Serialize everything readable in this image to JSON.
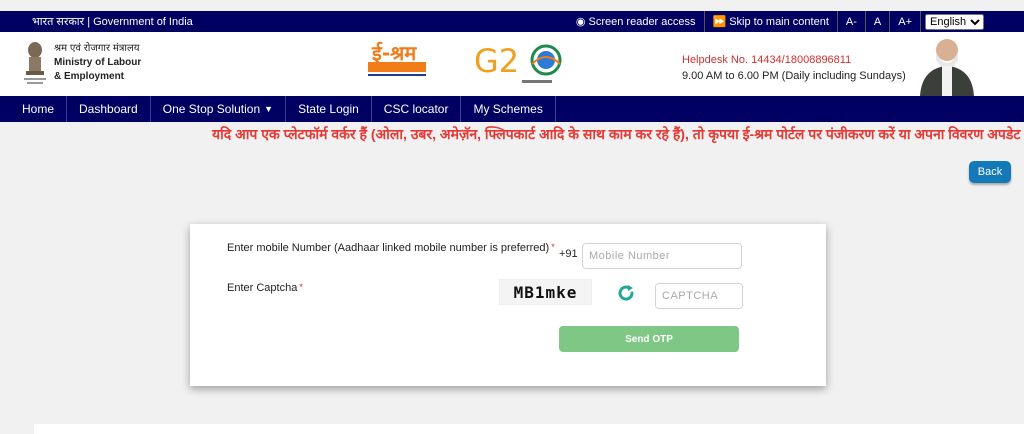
{
  "topbar": {
    "gov_text": "भारत सरकार | Government of India",
    "screen_reader": "Screen reader access",
    "skip_main": "Skip to main content",
    "font_minus": "A-",
    "font_normal": "A",
    "font_plus": "A+",
    "language": "English"
  },
  "header": {
    "ministry_hi": "श्रम एवं रोजगार मंत्रालय",
    "ministry_en_1": "Ministry of Labour",
    "ministry_en_2": "& Employment",
    "eshram_logo_text": "ई-श्रम",
    "g20_text": "G20",
    "helpdesk_no": "Helpdesk No. 14434/18008896811",
    "helpdesk_hours": "9.00 AM to 6.00 PM (Daily including Sundays)"
  },
  "nav": {
    "items": [
      "Home",
      "Dashboard",
      "One Stop Solution",
      "State Login",
      "CSC locator",
      "My Schemes"
    ]
  },
  "ticker": "यदि आप एक प्लेटफॉर्म वर्कर हैं (ओला, उबर, अमेज़ॅन, फ्लिपकार्ट आदि के साथ काम कर रहे हैं), तो कृपया ई-श्रम पोर्टल पर पंजीकरण करें या अपना विवरण अपडेट क",
  "back_label": "Back",
  "form": {
    "mobile_label": "Enter mobile Number (Aadhaar linked mobile number is preferred)",
    "required_mark": "*",
    "country_code": "+91",
    "mobile_placeholder": "Mobile Number",
    "captcha_label": "Enter Captcha",
    "captcha_text": "MB1mke",
    "captcha_placeholder": "CAPTCHA",
    "send_otp": "Send OTP"
  },
  "colors": {
    "navy": "#000062",
    "ticker_red": "#e53935",
    "back_blue": "#1479b8",
    "send_green": "#7fc784",
    "refresh_teal": "#26a69a"
  },
  "icons": [
    "eye-icon",
    "skip-icon",
    "emblem-icon",
    "eshram-logo",
    "g20-logo",
    "refresh-icon",
    "caret-down-icon"
  ]
}
